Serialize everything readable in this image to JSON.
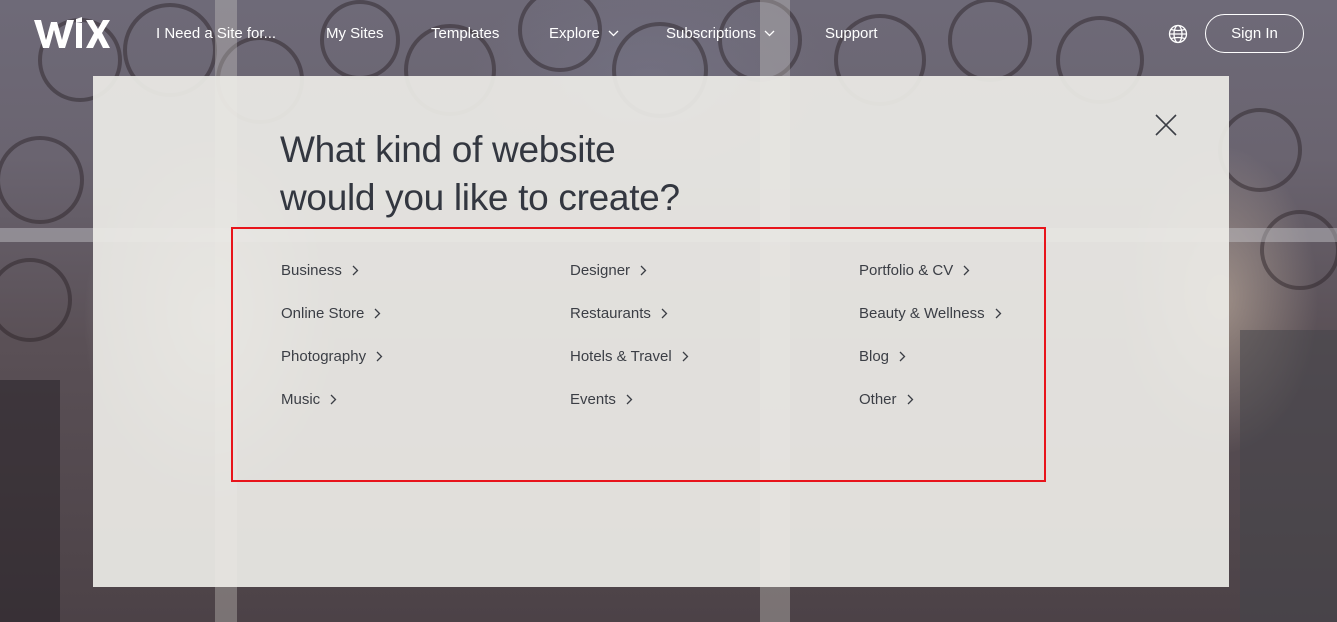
{
  "header": {
    "logo_text": "WiX",
    "nav": [
      {
        "label": "I Need a Site for...",
        "has_dropdown": false
      },
      {
        "label": "My Sites",
        "has_dropdown": false
      },
      {
        "label": "Templates",
        "has_dropdown": false
      },
      {
        "label": "Explore",
        "has_dropdown": true
      },
      {
        "label": "Subscriptions",
        "has_dropdown": true
      },
      {
        "label": "Support",
        "has_dropdown": false
      }
    ],
    "language_icon": "globe-icon",
    "sign_in_label": "Sign In"
  },
  "modal": {
    "title_line1": "What kind of website",
    "title_line2": "would you like to create?",
    "close_icon": "close-icon",
    "highlight_color": "#e8141b",
    "categories": {
      "col1": [
        "Business",
        "Online Store",
        "Photography",
        "Music"
      ],
      "col2": [
        "Designer",
        "Restaurants",
        "Hotels & Travel",
        "Events"
      ],
      "col3": [
        "Portfolio & CV",
        "Beauty & Wellness",
        "Blog",
        "Other"
      ]
    }
  }
}
